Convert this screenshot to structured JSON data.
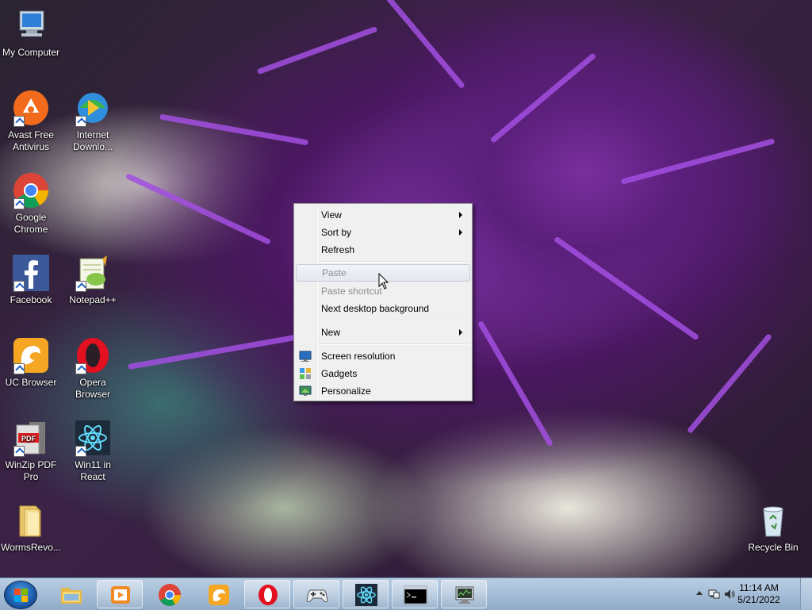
{
  "desktop": {
    "icons": [
      {
        "label_lines": [
          "My Computer"
        ],
        "icon": "computer-icon"
      },
      {
        "label_lines": [
          "Avast Free",
          "Antivirus"
        ],
        "icon": "avast-icon"
      },
      {
        "label_lines": [
          "Internet",
          "Downlo..."
        ],
        "icon": "internet-download-manager-icon"
      },
      {
        "label_lines": [
          "Google",
          "Chrome"
        ],
        "icon": "chrome-icon"
      },
      {
        "label_lines": [
          "Facebook"
        ],
        "icon": "facebook-icon"
      },
      {
        "label_lines": [
          "Notepad++"
        ],
        "icon": "notepad-plus-plus-icon"
      },
      {
        "label_lines": [
          "UC Browser"
        ],
        "icon": "uc-browser-icon"
      },
      {
        "label_lines": [
          "Opera",
          "Browser"
        ],
        "icon": "opera-icon"
      },
      {
        "label_lines": [
          "WinZip PDF",
          "Pro"
        ],
        "icon": "winzip-pdf-icon"
      },
      {
        "label_lines": [
          "Win11 in",
          "React"
        ],
        "icon": "react-icon"
      },
      {
        "label_lines": [
          "WormsRevo..."
        ],
        "icon": "folder-icon"
      },
      {
        "label_lines": [
          "Recycle Bin"
        ],
        "icon": "recycle-bin-icon"
      }
    ]
  },
  "context_menu": {
    "items": [
      {
        "label": "View",
        "submenu": true,
        "disabled": false
      },
      {
        "label": "Sort by",
        "submenu": true,
        "disabled": false
      },
      {
        "label": "Refresh",
        "submenu": false,
        "disabled": false
      },
      {
        "label": "Paste",
        "submenu": false,
        "disabled": true,
        "hovered": true
      },
      {
        "label": "Paste shortcut",
        "submenu": false,
        "disabled": true
      },
      {
        "label": "Next desktop background",
        "submenu": false,
        "disabled": false
      },
      {
        "label": "New",
        "submenu": true,
        "disabled": false
      },
      {
        "label": "Screen resolution",
        "icon": "screen-resolution-icon",
        "disabled": false
      },
      {
        "label": "Gadgets",
        "icon": "gadgets-icon",
        "disabled": false
      },
      {
        "label": "Personalize",
        "icon": "personalize-icon",
        "disabled": false
      }
    ]
  },
  "taskbar": {
    "start_icon": "windows-start-icon",
    "pinned": [
      "file-explorer-icon",
      "media-player-icon",
      "chrome-icon",
      "uc-browser-icon",
      "opera-icon",
      "game-controller-icon",
      "react-icon",
      "command-prompt-icon",
      "network-monitor-icon"
    ],
    "tray_icons": [
      "show-hidden-icons-icon",
      "network-icon",
      "volume-icon"
    ],
    "clock": {
      "time": "11:14 AM",
      "date": "5/21/2022"
    }
  },
  "colors": {
    "accent": "#1f5fbf",
    "menu_bg": "#f0f0f0",
    "taskbar": "#a7bfd8",
    "disabled_text": "#8d8d8d"
  }
}
